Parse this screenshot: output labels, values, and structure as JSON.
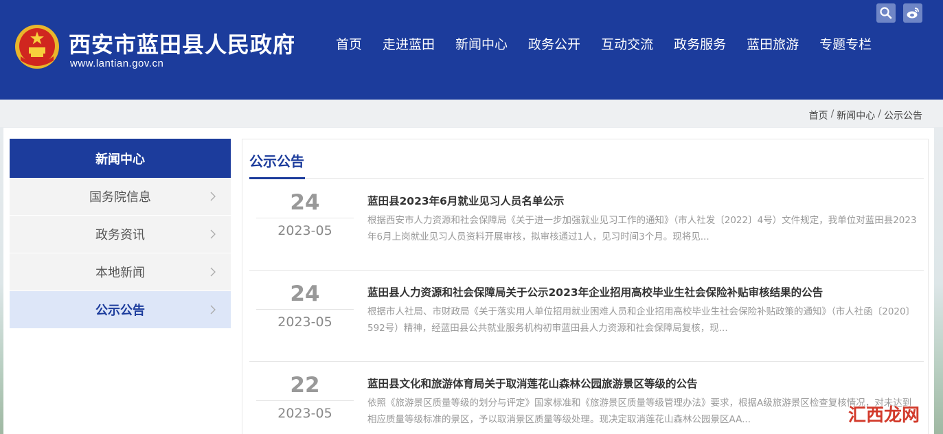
{
  "header": {
    "site_title": "西安市蓝田县人民政府",
    "site_url": "www.lantian.gov.cn",
    "nav": [
      "首页",
      "走进蓝田",
      "新闻中心",
      "政务公开",
      "互动交流",
      "政务服务",
      "蓝田旅游",
      "专题专栏"
    ],
    "icons": [
      "search-icon",
      "weibo-icon"
    ]
  },
  "breadcrumb": [
    "首页",
    "新闻中心",
    "公示公告"
  ],
  "sidebar": {
    "title": "新闻中心",
    "items": [
      {
        "label": "国务院信息",
        "active": false
      },
      {
        "label": "政务资讯",
        "active": false
      },
      {
        "label": "本地新闻",
        "active": false
      },
      {
        "label": "公示公告",
        "active": true
      }
    ]
  },
  "content": {
    "title": "公示公告",
    "items": [
      {
        "day": "24",
        "ym": "2023-05",
        "title": "蓝田县2023年6月就业见习人员名单公示",
        "summary": "根据西安市人力资源和社会保障局《关于进一步加强就业见习工作的通知》（市人社发〔2022〕4号）文件规定，我单位对蓝田县2023年6月上岗就业见习人员资料开展审核，拟审核通过1人，见习时间3个月。现将见..."
      },
      {
        "day": "24",
        "ym": "2023-05",
        "title": "蓝田县人力资源和社会保障局关于公示2023年企业招用高校毕业生社会保险补贴审核结果的公告",
        "summary": "根据市人社局、市财政局《关于落实用人单位招用就业困难人员和企业招用高校毕业生社会保险补贴政策的通知》（市人社函〔2020〕592号）精神，经蓝田县公共就业服务机构初审蓝田县人力资源和社会保障局复核，现..."
      },
      {
        "day": "22",
        "ym": "2023-05",
        "title": "蓝田县文化和旅游体育局关于取消莲花山森林公园旅游景区等级的公告",
        "summary": "依照《旅游景区质量等级的划分与评定》国家标准和《旅游景区质量等级管理办法》要求，根据A级旅游景区检查复核情况，对未达到相应质量等级标准的景区，予以取消景区质量等级处理。现决定取消莲花山森林公园景区AA..."
      }
    ]
  },
  "watermark": "汇西龙网",
  "colors": {
    "primary": "#1c3c9c",
    "active_bg": "#dde6f8",
    "date_gray": "#999999"
  }
}
